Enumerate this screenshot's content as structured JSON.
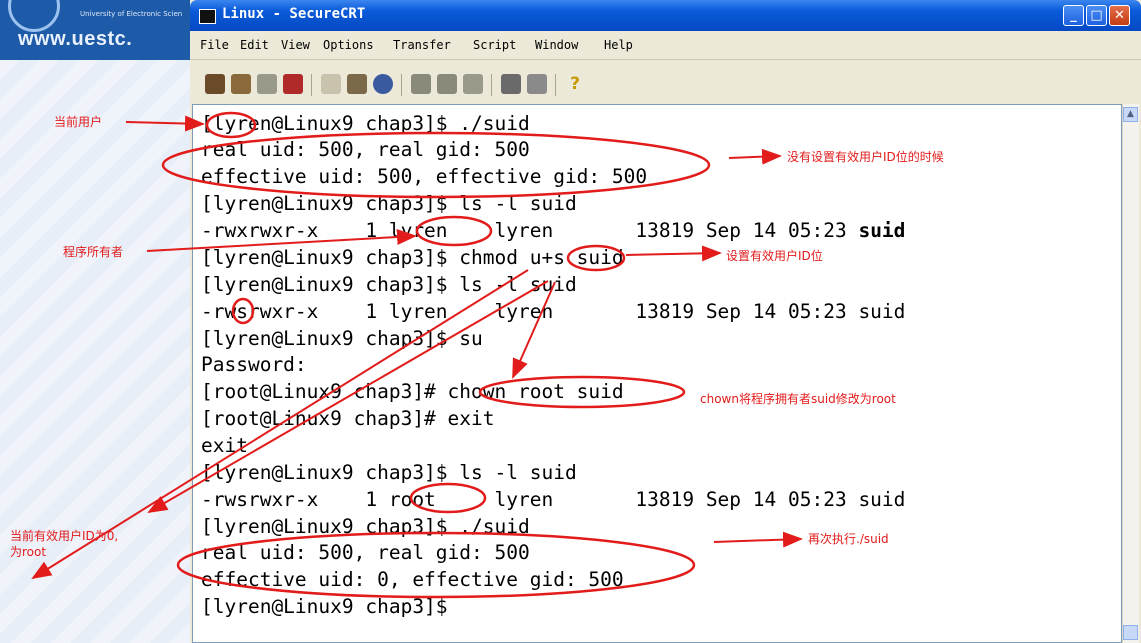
{
  "background": {
    "site_url": "www.uestc.",
    "university_small": "University of Electronic Scien"
  },
  "window": {
    "title": "Linux - SecureCRT",
    "controls": [
      "minimize",
      "maximize",
      "close"
    ]
  },
  "menu": [
    "File",
    "Edit",
    "View",
    "Options",
    "Transfer",
    "Script",
    "Window",
    "Help"
  ],
  "toolbar_icons": [
    "connect-icon",
    "quick-connect-icon",
    "reconnect-icon",
    "disconnect-icon",
    "copy-icon",
    "paste-icon",
    "find-icon",
    "print-icon",
    "print-selection-icon",
    "print-screen-icon",
    "session-options-icon",
    "global-options-icon",
    "help-icon"
  ],
  "terminal": {
    "lines": [
      "[lyren@Linux9 chap3]$ ./suid",
      "real uid: 500, real gid: 500",
      "effective uid: 500, effective gid: 500",
      "[lyren@Linux9 chap3]$ ls -l suid",
      "-rwxrwxr-x    1 lyren    lyren       13819 Sep 14 05:23 ",
      "[lyren@Linux9 chap3]$ chmod u+s suid",
      "[lyren@Linux9 chap3]$ ls -l suid",
      "-rwsrwxr-x    1 lyren    lyren       13819 Sep 14 05:23 suid",
      "[lyren@Linux9 chap3]$ su",
      "Password:",
      "[root@Linux9 chap3]# chown root suid",
      "[root@Linux9 chap3]# exit",
      "exit",
      "[lyren@Linux9 chap3]$ ls -l suid",
      "-rwsrwxr-x    1 root     lyren       13819 Sep 14 05:23 suid",
      "[lyren@Linux9 chap3]$ ./suid",
      "real uid: 500, real gid: 500",
      "effective uid: 0, effective gid: 500",
      "[lyren@Linux9 chap3]$"
    ],
    "bold_suffix_line4": "suid"
  },
  "annotations": {
    "current_user": "当前用户",
    "no_effective_uid_set": "没有设置有效用户ID位的时候",
    "program_owner": "程序所有者",
    "set_effective_uid": "设置有效用户ID位",
    "chown_note": "chown将程序拥有者suid修改为root",
    "effective_uid_zero_1": "当前有效用户ID为0,",
    "effective_uid_zero_2": "为root",
    "run_again": "再次执行./suid",
    "color": "#e21b1b"
  }
}
